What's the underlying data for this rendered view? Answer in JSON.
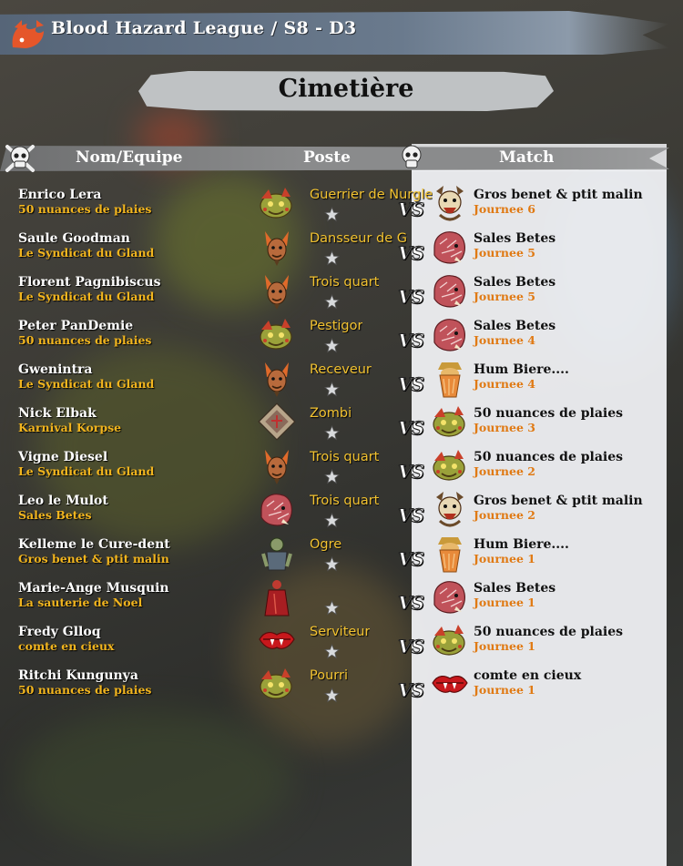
{
  "header": {
    "title": "Blood Hazard League / S8 - D3",
    "page_title": "Cimetière"
  },
  "columns": {
    "name": "Nom/Equipe",
    "position": "Poste",
    "match": "Match"
  },
  "colors": {
    "player_name": "#ffffff",
    "team_name": "#f2b51e",
    "position": "#f2c230",
    "match_team": "#111111",
    "match_day": "#e07a14"
  },
  "rows": [
    {
      "player": "Enrico Lera",
      "team": "50 nuances de plaies",
      "team_icon": "nurgle-icon",
      "position": "Guerrier de Nurgle",
      "opponent": "Gros benet & ptit malin",
      "opponent_icon": "ogre-chief-icon",
      "day": "Journee 6"
    },
    {
      "player": "Saule Goodman",
      "team": "Le Syndicat du Gland",
      "team_icon": "halfling-icon",
      "position": "Dansseur de G",
      "opponent": "Sales Betes",
      "opponent_icon": "chaos-beast-icon",
      "day": "Journee 5"
    },
    {
      "player": "Florent Pagnibiscus",
      "team": "Le Syndicat du Gland",
      "team_icon": "halfling-icon",
      "position": "Trois quart",
      "opponent": "Sales Betes",
      "opponent_icon": "chaos-beast-icon",
      "day": "Journee 5"
    },
    {
      "player": "Peter PanDemie",
      "team": "50 nuances de plaies",
      "team_icon": "nurgle-icon",
      "position": "Pestigor",
      "opponent": "Sales Betes",
      "opponent_icon": "chaos-beast-icon",
      "day": "Journee 4"
    },
    {
      "player": "Gwenintra",
      "team": "Le Syndicat du Gland",
      "team_icon": "halfling-icon",
      "position": "Receveur",
      "opponent": "Hum Biere....",
      "opponent_icon": "dwarf-icon",
      "day": "Journee 4"
    },
    {
      "player": "Nick Elbak",
      "team": "Karnival Korpse",
      "team_icon": "undead-icon",
      "position": "Zombi",
      "opponent": "50 nuances de plaies",
      "opponent_icon": "nurgle-icon",
      "day": "Journee 3"
    },
    {
      "player": "Vigne Diesel",
      "team": "Le Syndicat du Gland",
      "team_icon": "halfling-icon",
      "position": "Trois quart",
      "opponent": "50 nuances de plaies",
      "opponent_icon": "nurgle-icon",
      "day": "Journee 2"
    },
    {
      "player": "Leo le Mulot",
      "team": "Sales Betes",
      "team_icon": "chaos-beast-icon",
      "position": "Trois quart",
      "opponent": "Gros benet & ptit malin",
      "opponent_icon": "ogre-chief-icon",
      "day": "Journee 2"
    },
    {
      "player": "Kelleme le Cure-dent",
      "team": "Gros benet & ptit malin",
      "team_icon": "ogre-icon",
      "position": "Ogre",
      "opponent": "Hum Biere....",
      "opponent_icon": "dwarf-icon",
      "day": "Journee 1"
    },
    {
      "player": "Marie-Ange Musquin",
      "team": "La sauterie de Noel",
      "team_icon": "red-robe-icon",
      "position": "",
      "opponent": "Sales Betes",
      "opponent_icon": "chaos-beast-icon",
      "day": "Journee 1"
    },
    {
      "player": "Fredy Glloq",
      "team": "comte en cieux",
      "team_icon": "vampire-lips-icon",
      "position": "Serviteur",
      "opponent": "50 nuances de plaies",
      "opponent_icon": "nurgle-icon",
      "day": "Journee 1"
    },
    {
      "player": "Ritchi Kungunya",
      "team": "50 nuances de plaies",
      "team_icon": "nurgle-icon",
      "position": "Pourri",
      "opponent": "comte en cieux",
      "opponent_icon": "vampire-lips-icon",
      "day": "Journee 1"
    }
  ]
}
